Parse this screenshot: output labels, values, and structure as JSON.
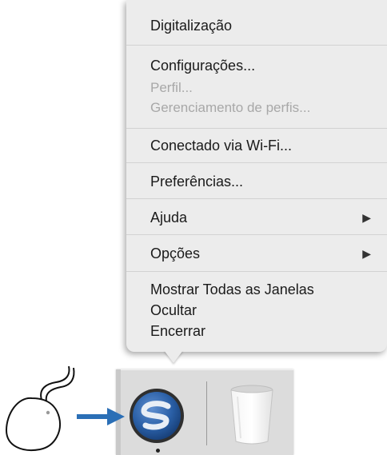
{
  "menu": {
    "items": [
      {
        "label": "Digitalização"
      },
      {
        "label": "Configurações..."
      },
      {
        "label": "Perfil..."
      },
      {
        "label": "Gerenciamento de perfis..."
      },
      {
        "label": "Conectado via Wi-Fi..."
      },
      {
        "label": "Preferências..."
      },
      {
        "label": "Ajuda"
      },
      {
        "label": "Opções"
      },
      {
        "label": "Mostrar Todas as Janelas"
      },
      {
        "label": "Ocultar"
      },
      {
        "label": "Encerrar"
      }
    ],
    "submenu_glyph": "▶"
  },
  "dock": {
    "app_icon": "scansnap-icon",
    "trash_icon": "trash-icon"
  },
  "colors": {
    "menu_bg": "#ececec",
    "dock_bg": "#dcdcdc",
    "arrow": "#2b6fb6",
    "app_icon_blue": "#2a5fa6"
  }
}
